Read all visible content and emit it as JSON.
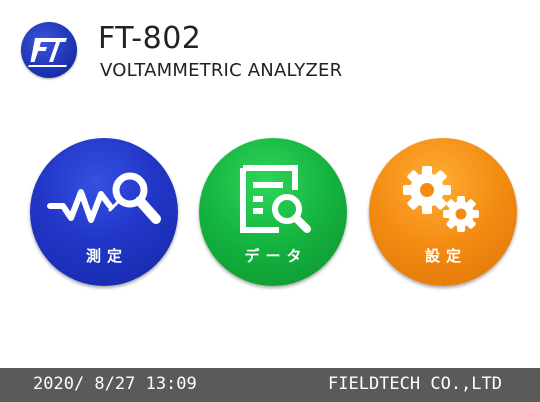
{
  "header": {
    "logo_text": "FT",
    "model": "FT-802",
    "subtitle": "VOLTAMMETRIC ANALYZER"
  },
  "menu": [
    {
      "label": "測定",
      "icon": "measure-magnifier-icon",
      "color": "#2136c6"
    },
    {
      "label": "データ",
      "icon": "data-document-search-icon",
      "color": "#14b23f"
    },
    {
      "label": "設定",
      "icon": "gears-icon",
      "color": "#f38a12"
    }
  ],
  "footer": {
    "datetime": "2020/ 8/27 13:09",
    "company": "FIELDTECH CO.,LTD"
  }
}
